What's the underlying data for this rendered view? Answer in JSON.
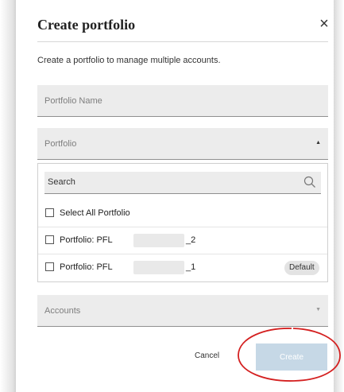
{
  "dialog": {
    "title": "Create portfolio",
    "close_glyph": "×",
    "description": "Create a portfolio to manage multiple accounts."
  },
  "fields": {
    "portfolio_name_placeholder": "Portfolio Name",
    "portfolio_label": "Portfolio",
    "accounts_label": "Accounts"
  },
  "dropdown": {
    "search_placeholder": "Search",
    "select_all_label": "Select All Portfolio",
    "items": [
      {
        "prefix": "Portfolio: PFL",
        "suffix": "_2",
        "badge": ""
      },
      {
        "prefix": "Portfolio: PFL",
        "suffix": "_1",
        "badge": "Default"
      }
    ]
  },
  "footer": {
    "cancel_label": "Cancel",
    "create_label": "Create"
  },
  "colors": {
    "create_button_disabled": "#c6d8e6",
    "annotation_circle": "#d42020",
    "field_background": "#ececec"
  },
  "icons": {
    "close": "close-icon",
    "search": "search-icon",
    "caret_up": "caret-up-icon",
    "caret_down": "caret-down-icon",
    "checkbox": "checkbox-icon"
  }
}
